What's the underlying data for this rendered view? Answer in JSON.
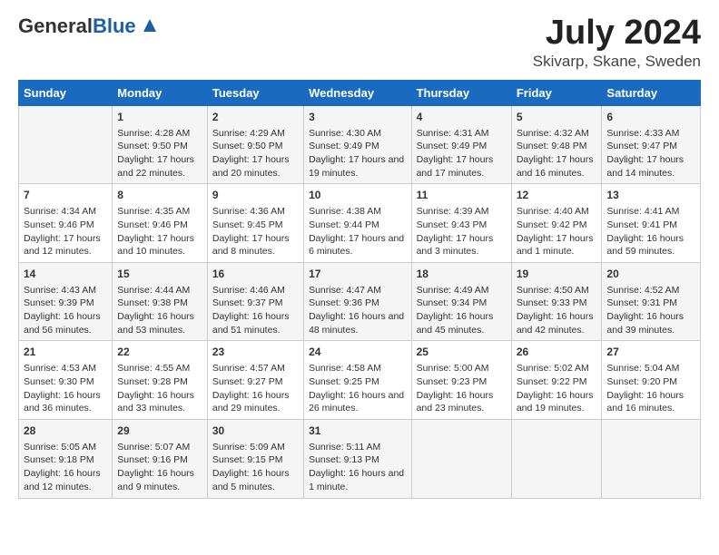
{
  "header": {
    "logo_general": "General",
    "logo_blue": "Blue",
    "title": "July 2024",
    "subtitle": "Skivarp, Skane, Sweden"
  },
  "days": [
    "Sunday",
    "Monday",
    "Tuesday",
    "Wednesday",
    "Thursday",
    "Friday",
    "Saturday"
  ],
  "weeks": [
    [
      {
        "date": "",
        "content": ""
      },
      {
        "date": "1",
        "content": "Sunrise: 4:28 AM\nSunset: 9:50 PM\nDaylight: 17 hours and 22 minutes."
      },
      {
        "date": "2",
        "content": "Sunrise: 4:29 AM\nSunset: 9:50 PM\nDaylight: 17 hours and 20 minutes."
      },
      {
        "date": "3",
        "content": "Sunrise: 4:30 AM\nSunset: 9:49 PM\nDaylight: 17 hours and 19 minutes."
      },
      {
        "date": "4",
        "content": "Sunrise: 4:31 AM\nSunset: 9:49 PM\nDaylight: 17 hours and 17 minutes."
      },
      {
        "date": "5",
        "content": "Sunrise: 4:32 AM\nSunset: 9:48 PM\nDaylight: 17 hours and 16 minutes."
      },
      {
        "date": "6",
        "content": "Sunrise: 4:33 AM\nSunset: 9:47 PM\nDaylight: 17 hours and 14 minutes."
      }
    ],
    [
      {
        "date": "7",
        "content": "Sunrise: 4:34 AM\nSunset: 9:46 PM\nDaylight: 17 hours and 12 minutes."
      },
      {
        "date": "8",
        "content": "Sunrise: 4:35 AM\nSunset: 9:46 PM\nDaylight: 17 hours and 10 minutes."
      },
      {
        "date": "9",
        "content": "Sunrise: 4:36 AM\nSunset: 9:45 PM\nDaylight: 17 hours and 8 minutes."
      },
      {
        "date": "10",
        "content": "Sunrise: 4:38 AM\nSunset: 9:44 PM\nDaylight: 17 hours and 6 minutes."
      },
      {
        "date": "11",
        "content": "Sunrise: 4:39 AM\nSunset: 9:43 PM\nDaylight: 17 hours and 3 minutes."
      },
      {
        "date": "12",
        "content": "Sunrise: 4:40 AM\nSunset: 9:42 PM\nDaylight: 17 hours and 1 minute."
      },
      {
        "date": "13",
        "content": "Sunrise: 4:41 AM\nSunset: 9:41 PM\nDaylight: 16 hours and 59 minutes."
      }
    ],
    [
      {
        "date": "14",
        "content": "Sunrise: 4:43 AM\nSunset: 9:39 PM\nDaylight: 16 hours and 56 minutes."
      },
      {
        "date": "15",
        "content": "Sunrise: 4:44 AM\nSunset: 9:38 PM\nDaylight: 16 hours and 53 minutes."
      },
      {
        "date": "16",
        "content": "Sunrise: 4:46 AM\nSunset: 9:37 PM\nDaylight: 16 hours and 51 minutes."
      },
      {
        "date": "17",
        "content": "Sunrise: 4:47 AM\nSunset: 9:36 PM\nDaylight: 16 hours and 48 minutes."
      },
      {
        "date": "18",
        "content": "Sunrise: 4:49 AM\nSunset: 9:34 PM\nDaylight: 16 hours and 45 minutes."
      },
      {
        "date": "19",
        "content": "Sunrise: 4:50 AM\nSunset: 9:33 PM\nDaylight: 16 hours and 42 minutes."
      },
      {
        "date": "20",
        "content": "Sunrise: 4:52 AM\nSunset: 9:31 PM\nDaylight: 16 hours and 39 minutes."
      }
    ],
    [
      {
        "date": "21",
        "content": "Sunrise: 4:53 AM\nSunset: 9:30 PM\nDaylight: 16 hours and 36 minutes."
      },
      {
        "date": "22",
        "content": "Sunrise: 4:55 AM\nSunset: 9:28 PM\nDaylight: 16 hours and 33 minutes."
      },
      {
        "date": "23",
        "content": "Sunrise: 4:57 AM\nSunset: 9:27 PM\nDaylight: 16 hours and 29 minutes."
      },
      {
        "date": "24",
        "content": "Sunrise: 4:58 AM\nSunset: 9:25 PM\nDaylight: 16 hours and 26 minutes."
      },
      {
        "date": "25",
        "content": "Sunrise: 5:00 AM\nSunset: 9:23 PM\nDaylight: 16 hours and 23 minutes."
      },
      {
        "date": "26",
        "content": "Sunrise: 5:02 AM\nSunset: 9:22 PM\nDaylight: 16 hours and 19 minutes."
      },
      {
        "date": "27",
        "content": "Sunrise: 5:04 AM\nSunset: 9:20 PM\nDaylight: 16 hours and 16 minutes."
      }
    ],
    [
      {
        "date": "28",
        "content": "Sunrise: 5:05 AM\nSunset: 9:18 PM\nDaylight: 16 hours and 12 minutes."
      },
      {
        "date": "29",
        "content": "Sunrise: 5:07 AM\nSunset: 9:16 PM\nDaylight: 16 hours and 9 minutes."
      },
      {
        "date": "30",
        "content": "Sunrise: 5:09 AM\nSunset: 9:15 PM\nDaylight: 16 hours and 5 minutes."
      },
      {
        "date": "31",
        "content": "Sunrise: 5:11 AM\nSunset: 9:13 PM\nDaylight: 16 hours and 1 minute."
      },
      {
        "date": "",
        "content": ""
      },
      {
        "date": "",
        "content": ""
      },
      {
        "date": "",
        "content": ""
      }
    ]
  ]
}
